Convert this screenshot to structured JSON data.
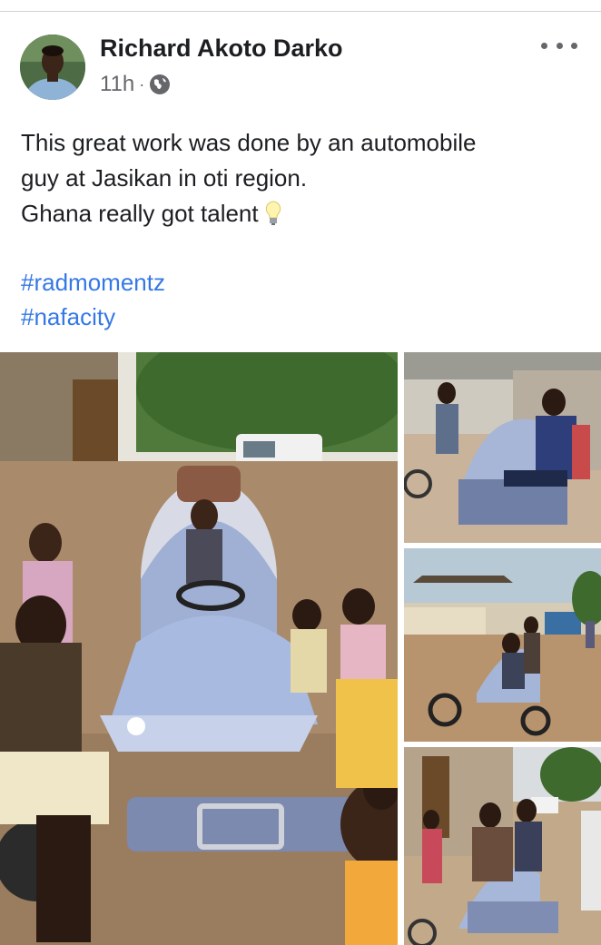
{
  "post": {
    "author": "Richard Akoto Darko",
    "time": "11h",
    "separator": "·",
    "privacy_icon": "globe-icon",
    "menu_icon": "more-options-icon",
    "text_lines": [
      "This  great work was done by an automobile",
      "guy at Jasikan in oti region.",
      "Ghana really got talent"
    ],
    "emoji": "light-bulb-icon",
    "hashtags": [
      "#radmomentz",
      "#nafacity"
    ]
  },
  "colors": {
    "link": "#3578e5",
    "text": "#1c1e21",
    "secondary": "#65676b"
  },
  "photos": [
    {
      "name": "photo-main",
      "content": "vehicle-with-people"
    },
    {
      "name": "photo-2",
      "content": "woman-seated-in-vehicle"
    },
    {
      "name": "photo-3",
      "content": "vehicle-on-road"
    },
    {
      "name": "photo-4",
      "content": "vehicle-with-crowd"
    }
  ]
}
